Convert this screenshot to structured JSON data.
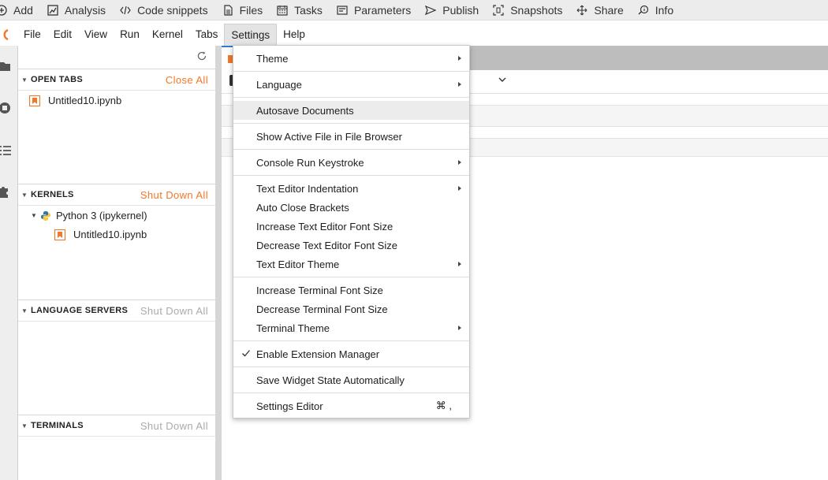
{
  "app_toolbar": {
    "items": [
      {
        "label": "Add",
        "icon": "plus-circle-icon"
      },
      {
        "label": "Analysis",
        "icon": "analysis-icon"
      },
      {
        "label": "Code snippets",
        "icon": "code-icon"
      },
      {
        "label": "Files",
        "icon": "file-icon"
      },
      {
        "label": "Tasks",
        "icon": "calendar-icon"
      },
      {
        "label": "Parameters",
        "icon": "parameters-icon"
      },
      {
        "label": "Publish",
        "icon": "publish-icon"
      },
      {
        "label": "Snapshots",
        "icon": "snapshot-icon"
      },
      {
        "label": "Share",
        "icon": "share-icon"
      },
      {
        "label": "Info",
        "icon": "info-icon"
      }
    ]
  },
  "menubar": {
    "items": [
      "File",
      "Edit",
      "View",
      "Run",
      "Kernel",
      "Tabs",
      "Settings",
      "Help"
    ],
    "active": "Settings"
  },
  "sidepanel": {
    "open_tabs": {
      "title": "OPEN TABS",
      "action": "Close All",
      "files": [
        "Untitled10.ipynb"
      ]
    },
    "kernels": {
      "title": "KERNELS",
      "action": "Shut Down All",
      "kernel_name": "Python 3 (ipykernel)",
      "files": [
        "Untitled10.ipynb"
      ]
    },
    "language_servers": {
      "title": "LANGUAGE SERVERS",
      "action": "Shut Down All"
    },
    "terminals": {
      "title": "TERMINALS",
      "action": "Shut Down All"
    }
  },
  "settings_menu": {
    "items": [
      {
        "label": "Theme",
        "submenu": true
      },
      {
        "label": "Language",
        "submenu": true
      },
      {
        "label": "Autosave Documents",
        "highlighted": true
      },
      {
        "label": "Show Active File in File Browser"
      },
      {
        "label": "Console Run Keystroke",
        "submenu": true
      },
      {
        "label": "Text Editor Indentation",
        "submenu": true
      },
      {
        "label": "Auto Close Brackets"
      },
      {
        "label": "Increase Text Editor Font Size"
      },
      {
        "label": "Decrease Text Editor Font Size"
      },
      {
        "label": "Text Editor Theme",
        "submenu": true
      },
      {
        "label": "Increase Terminal Font Size"
      },
      {
        "label": "Decrease Terminal Font Size"
      },
      {
        "label": "Terminal Theme",
        "submenu": true
      },
      {
        "label": "Enable Extension Manager",
        "checked": true
      },
      {
        "label": "Save Widget State Automatically"
      },
      {
        "label": "Settings Editor",
        "shortcut": "⌘ ,"
      }
    ]
  },
  "colors": {
    "accent_orange": "#f37726",
    "disabled_gray": "#aaaaaa",
    "tab_blue": "#2b7cd3"
  }
}
